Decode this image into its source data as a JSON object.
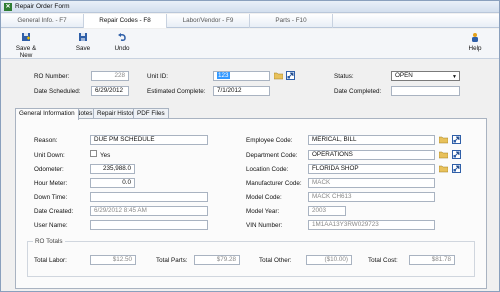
{
  "window": {
    "title": "Repair Order Form"
  },
  "top_tabs": [
    {
      "label": "General Info. - F7"
    },
    {
      "label": "Repair Codes - F8"
    },
    {
      "label": "Labor/Vendor - F9"
    },
    {
      "label": "Parts - F10"
    }
  ],
  "toolbar": {
    "save_new": "Save & New",
    "save": "Save",
    "undo": "Undo",
    "help": "Help"
  },
  "header": {
    "ro_number_label": "RO Number:",
    "ro_number": "228",
    "unit_id_label": "Unit ID:",
    "unit_id": "123",
    "status_label": "Status:",
    "status": "OPEN",
    "date_scheduled_label": "Date Scheduled:",
    "date_scheduled": "6/29/2012",
    "estimated_complete_label": "Estimated Complete:",
    "estimated_complete": "7/1/2012",
    "date_completed_label": "Date Completed:",
    "date_completed": ""
  },
  "sub_tabs": [
    {
      "label": "General Information"
    },
    {
      "label": "Notes"
    },
    {
      "label": "Repair History"
    },
    {
      "label": "PDF Files"
    }
  ],
  "general": {
    "reason_label": "Reason:",
    "reason": "DUE PM SCHEDULE",
    "unit_down_label": "Unit Down:",
    "unit_down_yes": "Yes",
    "odometer_label": "Odometer:",
    "odometer": "235,988.0",
    "hour_meter_label": "Hour Meter:",
    "hour_meter": "0.0",
    "down_time_label": "Down Time:",
    "down_time": "",
    "date_created_label": "Date Created:",
    "date_created": "6/29/2012 8:45 AM",
    "user_name_label": "User Name:",
    "user_name": "",
    "employee_code_label": "Employee Code:",
    "employee_code": "MERICAL, BILL",
    "department_code_label": "Department Code:",
    "department_code": "OPERATIONS",
    "location_code_label": "Location Code:",
    "location_code": "FLORIDA SHOP",
    "manufacturer_code_label": "Manufacturer Code:",
    "manufacturer_code": "MACK",
    "model_code_label": "Model Code:",
    "model_code": "MACK CH613",
    "model_year_label": "Model Year:",
    "model_year": "2003",
    "vin_label": "VIN Number:",
    "vin": "1M1AA13Y3RW029723"
  },
  "totals": {
    "group_label": "RO Totals",
    "labor_label": "Total Labor:",
    "labor": "$12.50",
    "parts_label": "Total Parts:",
    "parts": "$79.28",
    "other_label": "Total Other:",
    "other": "($10.00)",
    "cost_label": "Total Cost:",
    "cost": "$81.78"
  }
}
